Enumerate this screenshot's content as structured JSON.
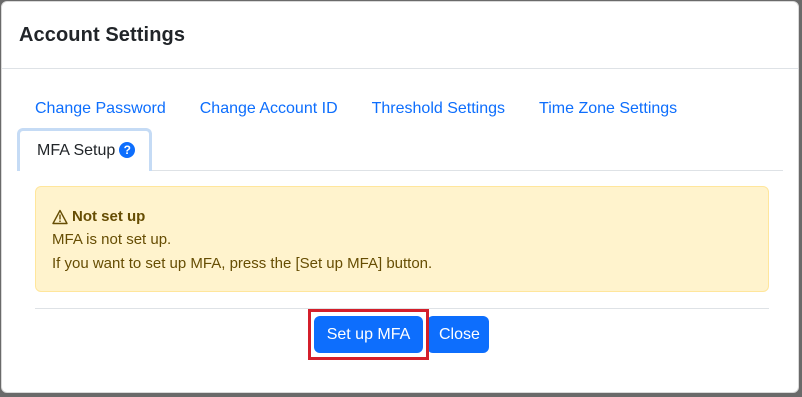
{
  "modal": {
    "title": "Account Settings"
  },
  "tabs": {
    "items": [
      {
        "label": "Change Password"
      },
      {
        "label": "Change Account ID"
      },
      {
        "label": "Threshold Settings"
      },
      {
        "label": "Time Zone Settings"
      }
    ],
    "active": {
      "label": "MFA Setup",
      "help_icon": "?"
    }
  },
  "alert": {
    "title": "Not set up",
    "icon": "warning-triangle-icon",
    "line1": "MFA is not set up.",
    "line2": "If you want to set up MFA, press the [Set up MFA] button."
  },
  "footer": {
    "setup_label": "Set up MFA",
    "close_label": "Close"
  },
  "colors": {
    "primary": "#0d6efd",
    "alert_bg": "#fff3cd",
    "alert_text": "#664d03",
    "highlight": "#d41f2b"
  }
}
